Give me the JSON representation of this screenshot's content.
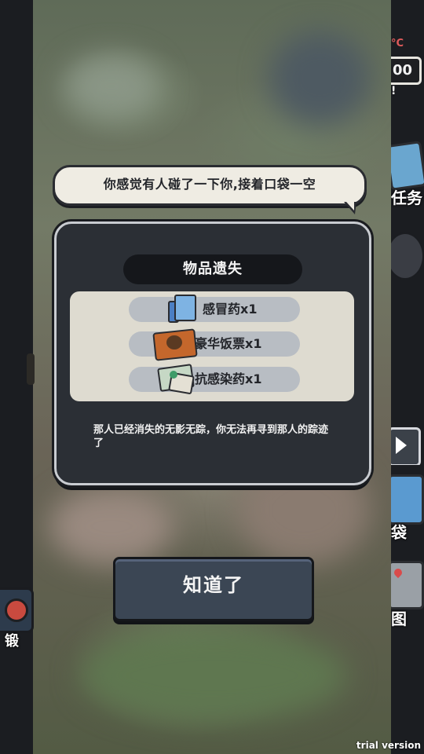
{
  "hud": {
    "temperature_unit": "°C",
    "temperature_value": "00",
    "alert_mark": "!",
    "task_label": "任务",
    "bag_label": "袋",
    "map_label": "图",
    "forge_label": "锻"
  },
  "bubble": {
    "text": "你感觉有人碰了一下你,接着口袋一空"
  },
  "dialog": {
    "title": "物品遗失",
    "items": [
      {
        "label": "感冒药x1",
        "icon": "cold-medicine-icon"
      },
      {
        "label": "豪华饭票x1",
        "icon": "meal-ticket-icon"
      },
      {
        "label": "抗感染药x1",
        "icon": "anti-infection-medicine-icon"
      }
    ],
    "description": "那人已经消失的无影无踪，你无法再寻到那人的踪迹了"
  },
  "confirm_button": {
    "label": "知道了"
  },
  "watermark": "trial version",
  "colors": {
    "panel_bg": "#2b2f35",
    "panel_border": "#c9ccd1",
    "item_pill": "#b8bdc3",
    "items_box": "#dedbd0",
    "button_bg": "#3b4654"
  }
}
